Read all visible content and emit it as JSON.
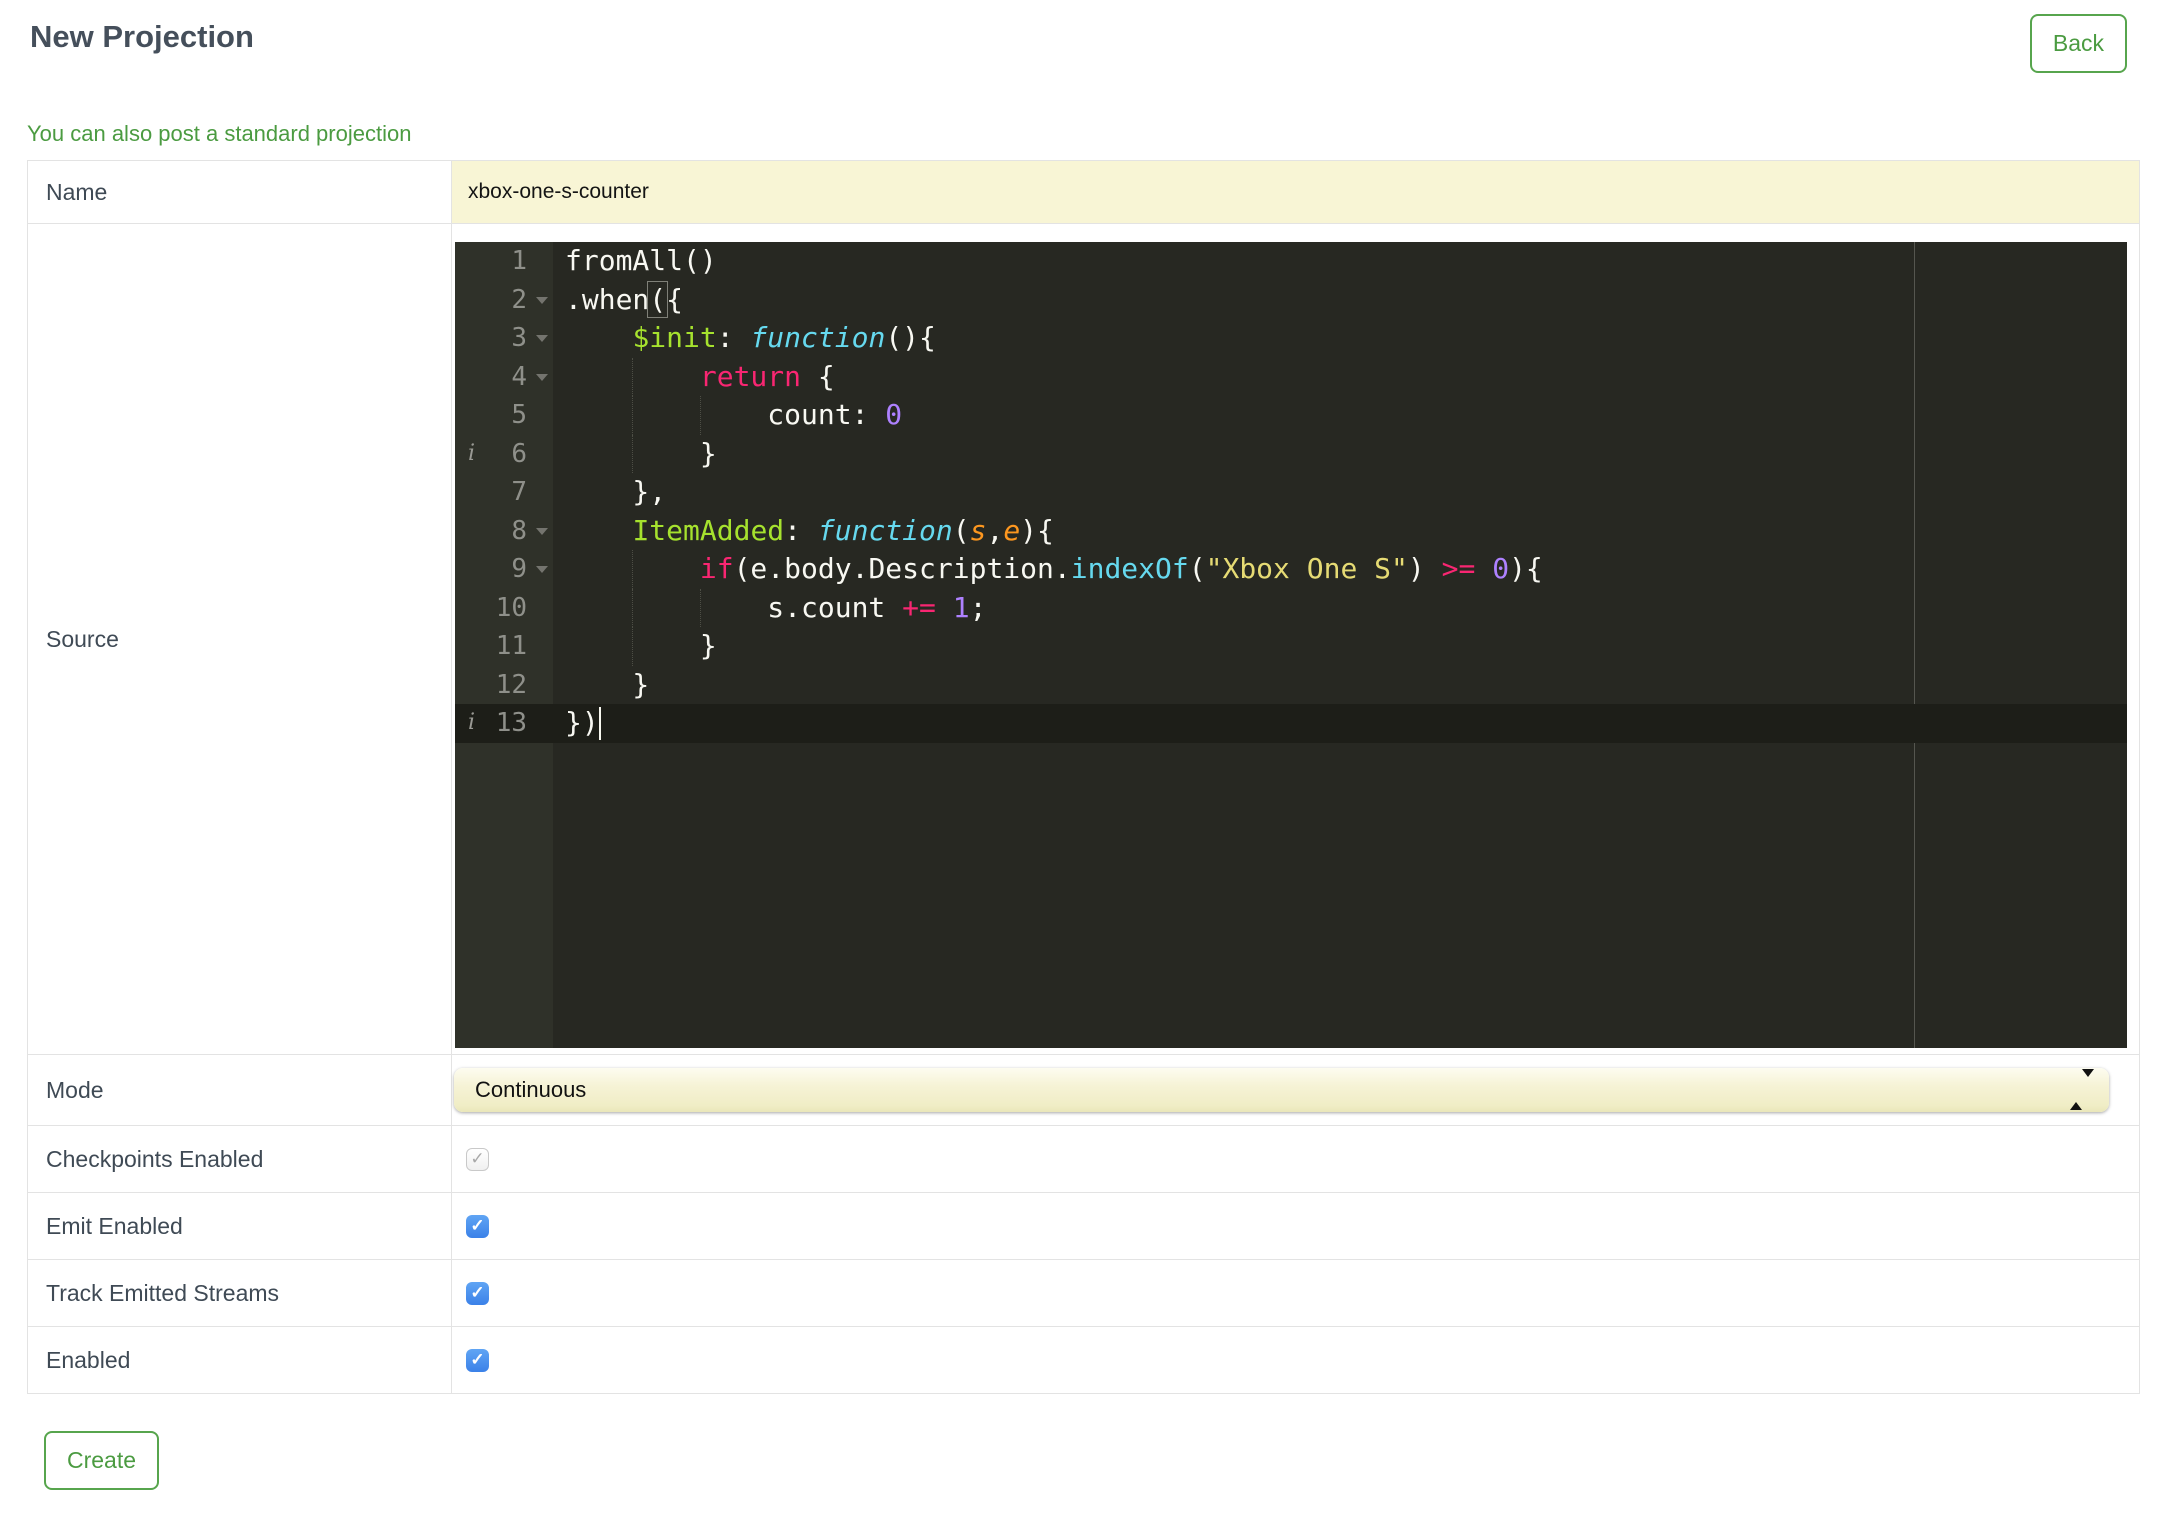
{
  "header": {
    "title": "New Projection",
    "back_button": "Back"
  },
  "link_text": "You can also post a standard projection",
  "actions": {
    "create_button": "Create"
  },
  "icons": {
    "checkmark": "✓"
  },
  "colors": {
    "accent_green": "#4B9B41",
    "heading": "#454F5B",
    "label": "#3F4A55",
    "checkbox_blue": "#3B81E8",
    "field_yellow": "#F8F5D5"
  },
  "form": {
    "name_label": "Name",
    "name_value": "xbox-one-s-counter",
    "source_label": "Source",
    "mode_label": "Mode",
    "mode_value": "Continuous",
    "checkbox_rows": [
      {
        "label": "Checkpoints Enabled",
        "checked": true,
        "disabled": true
      },
      {
        "label": "Emit Enabled",
        "checked": true,
        "disabled": false
      },
      {
        "label": "Track Emitted Streams",
        "checked": true,
        "disabled": false
      },
      {
        "label": "Enabled",
        "checked": true,
        "disabled": false
      }
    ]
  },
  "editor": {
    "language": "javascript",
    "active_line": 13,
    "cursor": {
      "line": 13,
      "column": 2
    },
    "annotations": {
      "info_lines": [
        6,
        13
      ],
      "fold_lines": [
        2,
        3,
        4,
        8,
        9
      ]
    },
    "colors": {
      "background": "#272822",
      "gutter": "#2F3129",
      "gutter_text": "#8F908A",
      "text": "#F8F8F2",
      "keyword": "#F92672",
      "storage": "#66D9EF",
      "entity": "#A6E22E",
      "string": "#E6DB74",
      "number": "#AE81FF",
      "param": "#FD971F",
      "active_line": "#1D1E18",
      "print_margin": "#55564F"
    },
    "lines": [
      {
        "n": 1,
        "segments": [
          [
            "fromAll()",
            "plain"
          ]
        ]
      },
      {
        "n": 2,
        "segments": [
          [
            ".when",
            "plain"
          ],
          [
            "(",
            "bracket"
          ],
          [
            "{",
            "plain"
          ]
        ]
      },
      {
        "n": 3,
        "segments": [
          [
            "    ",
            "plain"
          ],
          [
            "$init",
            "entity"
          ],
          [
            ": ",
            "plain"
          ],
          [
            "function",
            "storage"
          ],
          [
            "(){",
            "plain"
          ]
        ]
      },
      {
        "n": 4,
        "segments": [
          [
            "        ",
            "plain"
          ],
          [
            "return",
            "keyword"
          ],
          [
            " {",
            "plain"
          ]
        ]
      },
      {
        "n": 5,
        "segments": [
          [
            "            count: ",
            "plain"
          ],
          [
            "0",
            "number"
          ]
        ]
      },
      {
        "n": 6,
        "segments": [
          [
            "        }",
            "plain"
          ]
        ]
      },
      {
        "n": 7,
        "segments": [
          [
            "    },",
            "plain"
          ]
        ]
      },
      {
        "n": 8,
        "segments": [
          [
            "    ",
            "plain"
          ],
          [
            "ItemAdded",
            "entity"
          ],
          [
            ": ",
            "plain"
          ],
          [
            "function",
            "storage"
          ],
          [
            "(",
            "plain"
          ],
          [
            "s",
            "param"
          ],
          [
            ",",
            "plain"
          ],
          [
            "e",
            "param"
          ],
          [
            "){",
            "plain"
          ]
        ]
      },
      {
        "n": 9,
        "segments": [
          [
            "        ",
            "plain"
          ],
          [
            "if",
            "keyword"
          ],
          [
            "(e.body.Description.",
            "plain"
          ],
          [
            "indexOf",
            "support"
          ],
          [
            "(",
            "plain"
          ],
          [
            "\"Xbox One S\"",
            "string"
          ],
          [
            ") ",
            "plain"
          ],
          [
            ">=",
            "keyword"
          ],
          [
            " ",
            "plain"
          ],
          [
            "0",
            "number"
          ],
          [
            "){",
            "plain"
          ]
        ]
      },
      {
        "n": 10,
        "segments": [
          [
            "            s.count ",
            "plain"
          ],
          [
            "+=",
            "keyword"
          ],
          [
            " ",
            "plain"
          ],
          [
            "1",
            "number"
          ],
          [
            ";",
            "plain"
          ]
        ]
      },
      {
        "n": 11,
        "segments": [
          [
            "        }",
            "plain"
          ]
        ]
      },
      {
        "n": 12,
        "segments": [
          [
            "    }",
            "plain"
          ]
        ]
      },
      {
        "n": 13,
        "segments": [
          [
            "})",
            "plain"
          ]
        ]
      }
    ]
  }
}
